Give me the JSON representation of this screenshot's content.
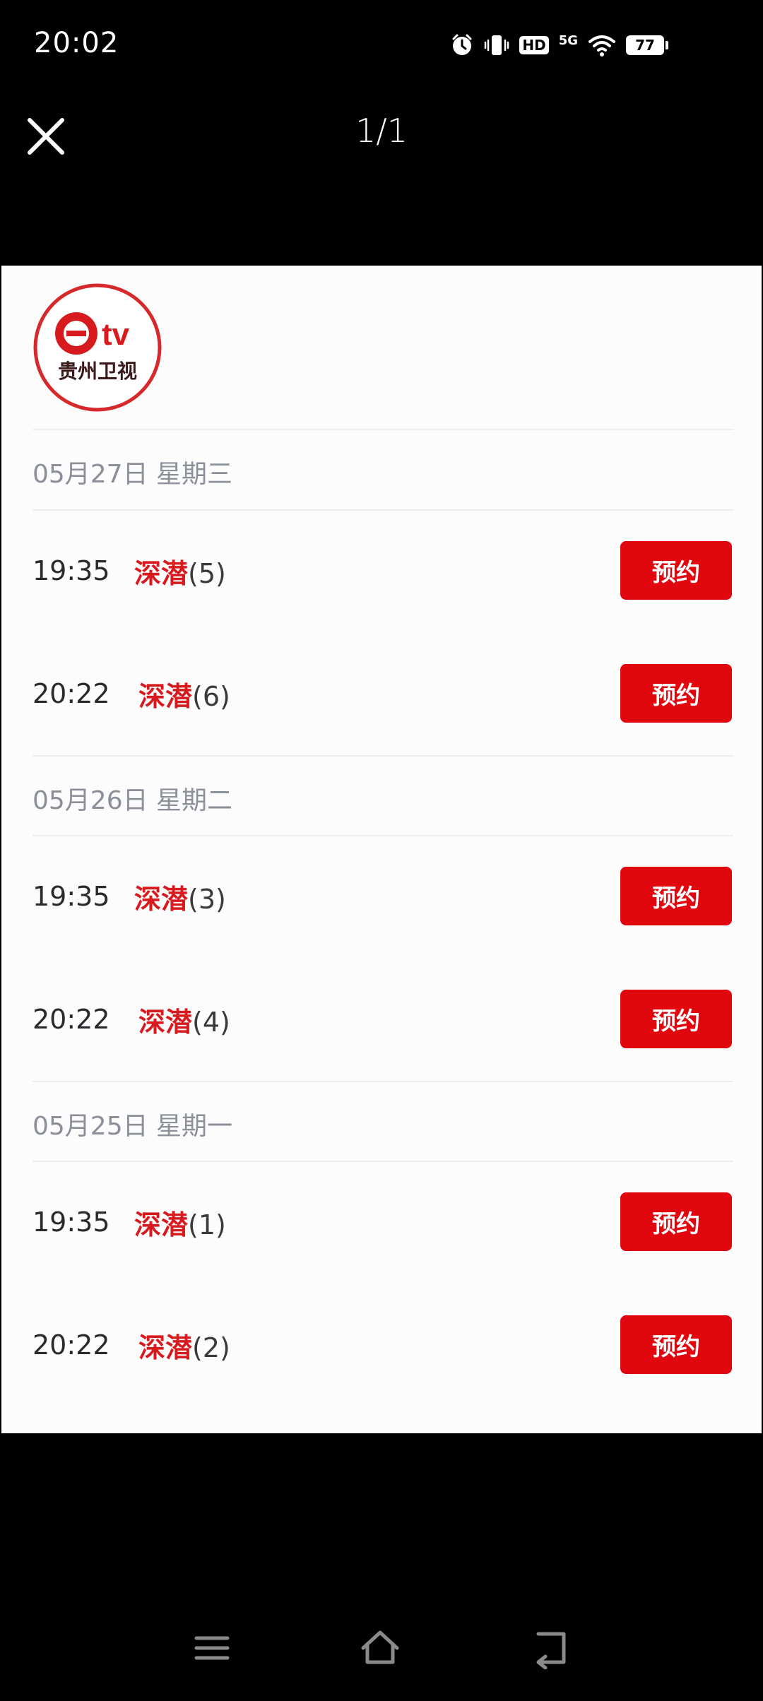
{
  "status_bar": {
    "time": "20:02",
    "hd": "HD",
    "network": "5G",
    "battery": "77",
    "icons": [
      "alarm-icon",
      "vibrate-icon",
      "hd-icon",
      "signal-icon",
      "wifi-icon",
      "battery-icon"
    ]
  },
  "viewer": {
    "page_indicator": "1/1",
    "close_icon": "close-icon"
  },
  "logo": {
    "brand_tv": "tv",
    "channel_name": "贵州卫视"
  },
  "schedule": [
    {
      "date": "05月27日 星期三",
      "items": [
        {
          "time": "19:35",
          "name": "深潜",
          "episode": "(5)",
          "button": "预约"
        },
        {
          "time": "20:22",
          "name": "深潜",
          "episode": "(6)",
          "button": "预约"
        }
      ]
    },
    {
      "date": "05月26日 星期二",
      "items": [
        {
          "time": "19:35",
          "name": "深潜",
          "episode": "(3)",
          "button": "预约"
        },
        {
          "time": "20:22",
          "name": "深潜",
          "episode": "(4)",
          "button": "预约"
        }
      ]
    },
    {
      "date": "05月25日 星期一",
      "items": [
        {
          "time": "19:35",
          "name": "深潜",
          "episode": "(1)",
          "button": "预约"
        },
        {
          "time": "20:22",
          "name": "深潜",
          "episode": "(2)",
          "button": "预约"
        }
      ]
    }
  ],
  "nav_bar": {
    "icons": [
      "menu-icon",
      "home-icon",
      "back-icon"
    ]
  },
  "colors": {
    "accent": "#e0070e",
    "title_red": "#d61a1e",
    "date_gray": "#8a8f99"
  }
}
